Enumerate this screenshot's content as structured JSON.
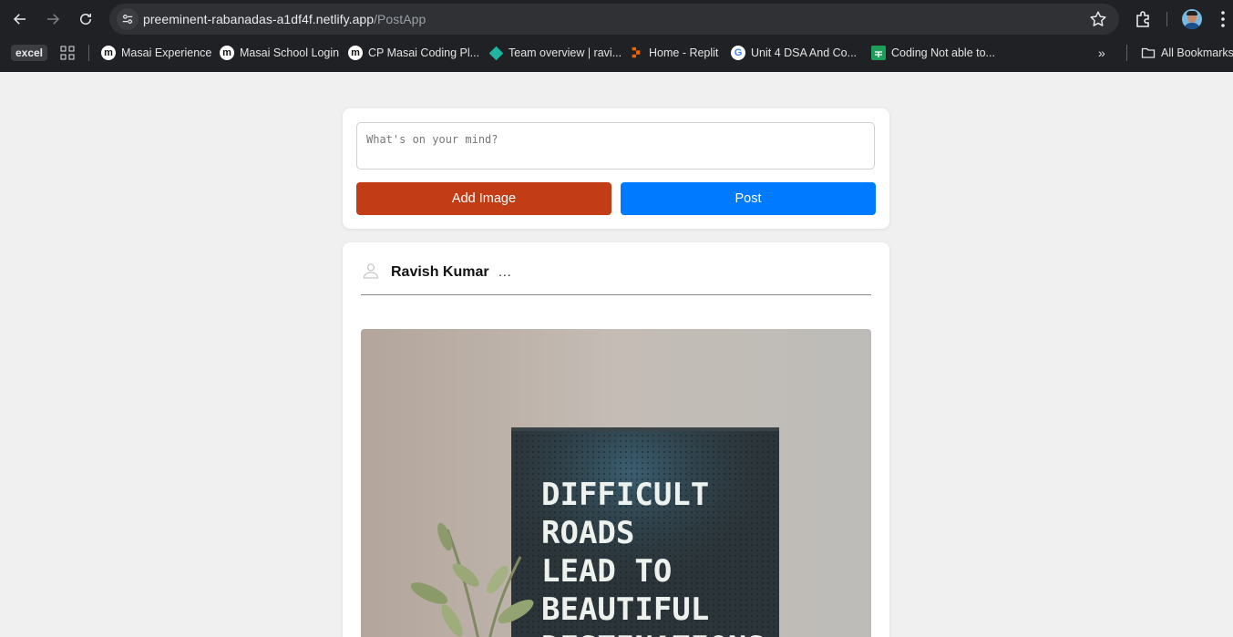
{
  "browser": {
    "url_host": "preeminent-rabanadas-a1df4f.netlify.app",
    "url_path": "/PostApp",
    "bookmarks": [
      {
        "label": "excel"
      },
      {
        "label": "Masai Experience"
      },
      {
        "label": "Masai School Login"
      },
      {
        "label": "CP Masai Coding Pl..."
      },
      {
        "label": "Team overview | ravi..."
      },
      {
        "label": "Home - Replit"
      },
      {
        "label": "Unit 4 DSA And Co..."
      },
      {
        "label": "Coding Not able to..."
      },
      {
        "label": "All Bookmarks"
      }
    ],
    "more_bookmarks_label": "»"
  },
  "composer": {
    "placeholder": "What's on your mind?",
    "add_image_label": "Add Image",
    "post_label": "Post",
    "add_image_color": "#c23c16",
    "post_color": "#007bff"
  },
  "post": {
    "author": "Ravish Kumar",
    "menu_label": "...",
    "image_text_lines": [
      "DIFFICULT",
      "ROADS",
      "LEAD TO",
      "BEAUTIFUL",
      "DESTINATIONS"
    ]
  }
}
